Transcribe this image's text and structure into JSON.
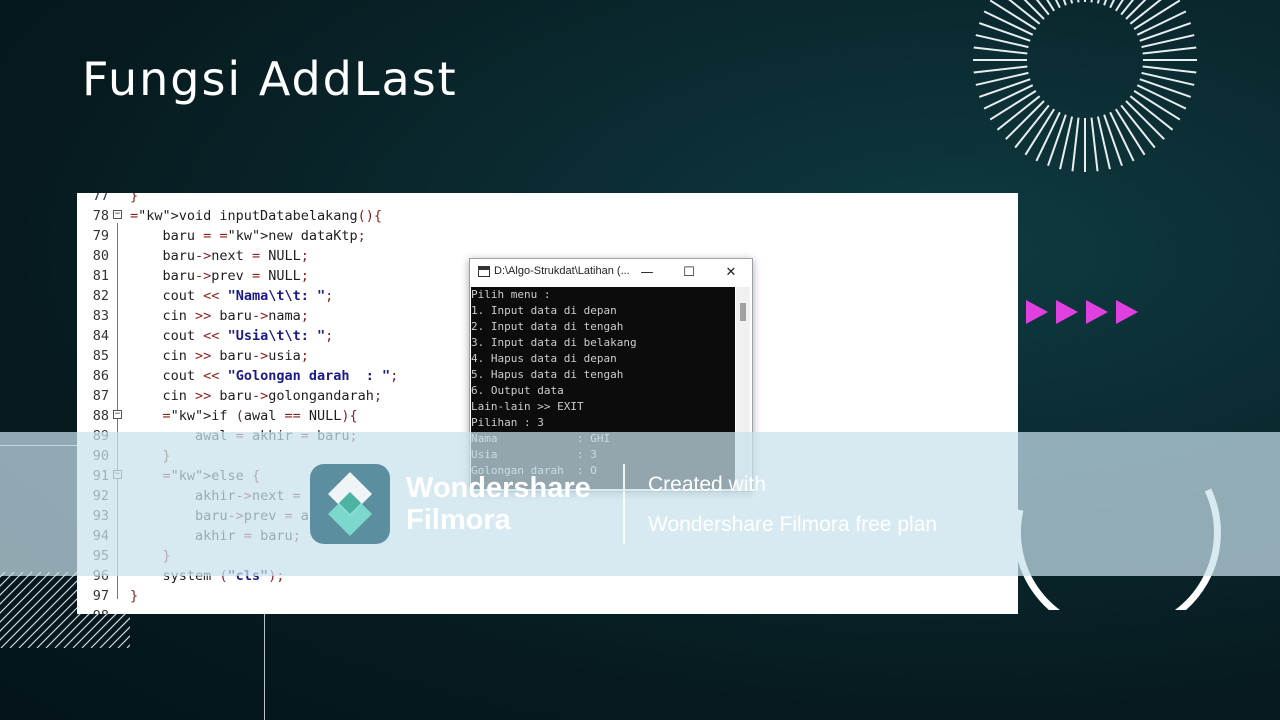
{
  "slide": {
    "title": "Fungsi AddLast"
  },
  "editor": {
    "lines": [
      {
        "n": "77",
        "text": "}"
      },
      {
        "n": "78",
        "text": "void inputDatabelakang(){"
      },
      {
        "n": "79",
        "text": "    baru = new dataKtp;"
      },
      {
        "n": "80",
        "text": "    baru->next = NULL;"
      },
      {
        "n": "81",
        "text": "    baru->prev = NULL;"
      },
      {
        "n": "82",
        "text": "    cout << \"Nama\\t\\t: \";"
      },
      {
        "n": "83",
        "text": "    cin >> baru->nama;"
      },
      {
        "n": "84",
        "text": "    cout << \"Usia\\t\\t: \";"
      },
      {
        "n": "85",
        "text": "    cin >> baru->usia;"
      },
      {
        "n": "86",
        "text": "    cout << \"Golongan darah  : \";"
      },
      {
        "n": "87",
        "text": "    cin >> baru->golongandarah;"
      },
      {
        "n": "88",
        "text": "    if (awal == NULL){"
      },
      {
        "n": "89",
        "text": "        awal = akhir = baru;"
      },
      {
        "n": "90",
        "text": "    }"
      },
      {
        "n": "91",
        "text": "    else {"
      },
      {
        "n": "92",
        "text": "        akhir->next = baru;"
      },
      {
        "n": "93",
        "text": "        baru->prev = akhir;"
      },
      {
        "n": "94",
        "text": "        akhir = baru;"
      },
      {
        "n": "95",
        "text": "    }"
      },
      {
        "n": "96",
        "text": "    system (\"cls\");"
      },
      {
        "n": "97",
        "text": "}"
      },
      {
        "n": "98",
        "text": ""
      }
    ]
  },
  "console": {
    "title": "D:\\Algo-Strukdat\\Latihan (...",
    "minimize_label": "—",
    "maximize_label": "☐",
    "close_label": "✕",
    "lines": [
      "Pilih menu :",
      "1. Input data di depan",
      "2. Input data di tengah",
      "3. Input data di belakang",
      "4. Hapus data di depan",
      "5. Hapus data di tengah",
      "6. Output data",
      "Lain-lain >> EXIT",
      "Pilihan : 3",
      "Nama            : GHI",
      "Usia            : 3",
      "Golongan darah  : O"
    ]
  },
  "watermark": {
    "brand_line1": "Wondershare",
    "brand_line2": "Filmora",
    "created": "Created with",
    "plan": "Wondershare Filmora free plan"
  },
  "colors": {
    "background": "#0a2a30",
    "arrow_accent": "#e040e0",
    "code_keyword": "#000000",
    "code_string": "#1a1a8c",
    "code_operator": "#8b1c1c",
    "console_bg": "#0c0c0c",
    "console_text": "#cccccc"
  },
  "icons": {
    "console_app": "console-app-icon",
    "filmora_logo": "filmora-logo-icon"
  }
}
